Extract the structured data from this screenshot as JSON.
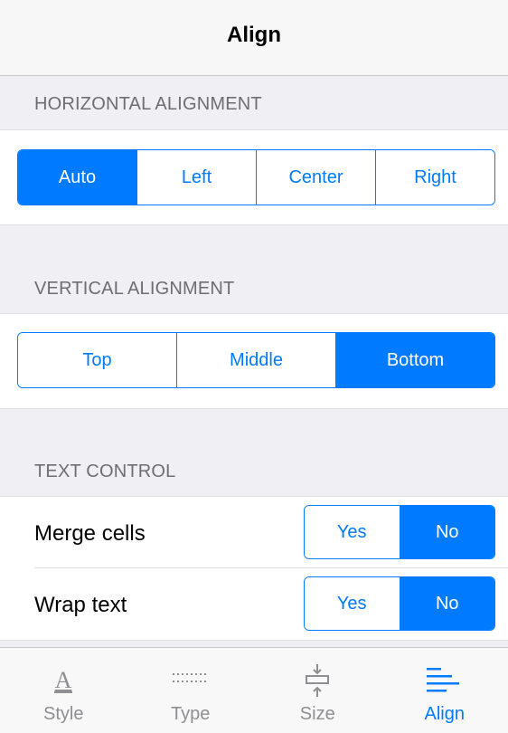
{
  "header": {
    "title": "Align"
  },
  "horizontal": {
    "label": "HORIZONTAL ALIGNMENT",
    "options": [
      "Auto",
      "Left",
      "Center",
      "Right"
    ],
    "selected": "Auto"
  },
  "vertical": {
    "label": "VERTICAL ALIGNMENT",
    "options": [
      "Top",
      "Middle",
      "Bottom"
    ],
    "selected": "Bottom"
  },
  "text_control": {
    "label": "TEXT CONTROL",
    "rows": [
      {
        "label": "Merge cells",
        "yes": "Yes",
        "no": "No",
        "selected": "No"
      },
      {
        "label": "Wrap text",
        "yes": "Yes",
        "no": "No",
        "selected": "No"
      }
    ]
  },
  "tabbar": {
    "tabs": [
      {
        "label": "Style",
        "icon": "text-style-icon"
      },
      {
        "label": "Type",
        "icon": "dotted-grid-icon"
      },
      {
        "label": "Size",
        "icon": "resize-height-icon"
      },
      {
        "label": "Align",
        "icon": "align-left-icon"
      }
    ],
    "active": "Align"
  },
  "colors": {
    "accent": "#007aff",
    "background": "#efeff4",
    "secondary_text": "#6d6d72"
  }
}
